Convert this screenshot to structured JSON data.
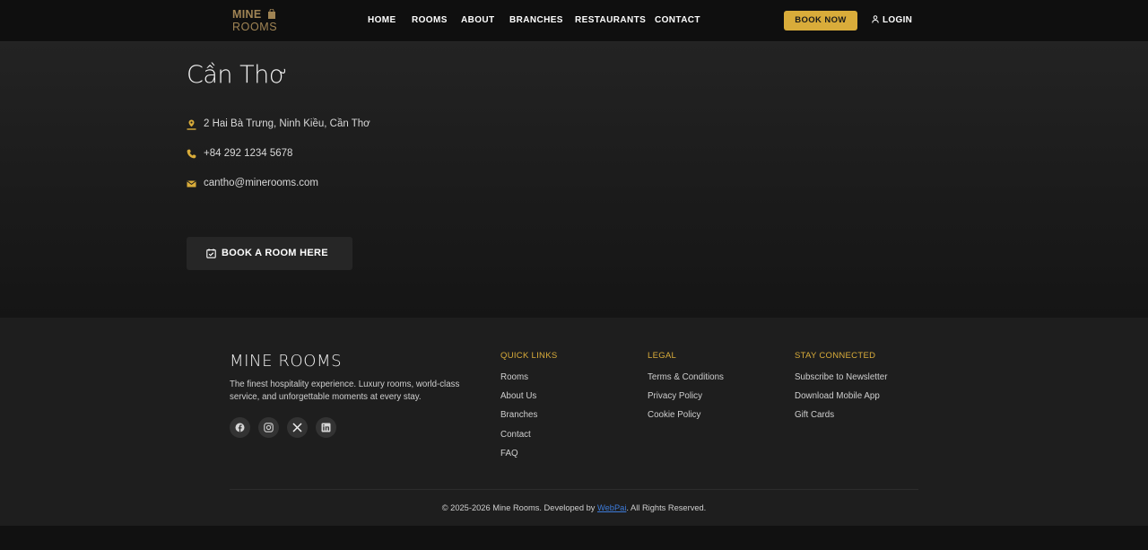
{
  "nav": {
    "logo_line1": "MINE",
    "logo_line2": "ROOMS",
    "items": [
      "HOME",
      "ROOMS",
      "ABOUT",
      "BRANCHES",
      "RESTAURANTS",
      "CONTACT"
    ],
    "book_now": "BOOK NOW",
    "login": "LOGIN",
    "icons": {
      "login": "user-icon",
      "logo": "shopping-bag-icon"
    }
  },
  "branch": {
    "city": "Cần Thơ",
    "address": "2 Hai Bà Trưng, Ninh Kiều, Cần Thơ",
    "phone": "+84 292 1234 5678",
    "email": "cantho@minerooms.com",
    "book_button": "BOOK A ROOM HERE",
    "icons": {
      "address": "location-pin-icon",
      "phone": "phone-icon",
      "email": "mail-icon",
      "book": "calendar-check-icon"
    }
  },
  "footer": {
    "brand": "MINE ROOMS",
    "tagline": "The finest hospitality experience. Luxury rooms, world-class service, and unforgettable moments at every stay.",
    "socials": [
      "facebook-icon",
      "instagram-icon",
      "x-icon",
      "linkedin-icon"
    ],
    "quick_links": {
      "title": "QUICK LINKS",
      "links": [
        "Rooms",
        "About Us",
        "Branches",
        "Contact",
        "FAQ"
      ]
    },
    "legal": {
      "title": "LEGAL",
      "links": [
        "Terms & Conditions",
        "Privacy Policy",
        "Cookie Policy"
      ]
    },
    "stay_connected": {
      "title": "STAY CONNECTED",
      "links": [
        "Subscribe to Newsletter",
        "Download Mobile App",
        "Gift Cards"
      ]
    },
    "copyright_prefix": "© 2025-2026 Mine Rooms. Developed by ",
    "developer": "WebPai",
    "copyright_suffix": ". All Rights Reserved."
  },
  "colors": {
    "accent": "#d9ac3a",
    "logo": "#a08454",
    "link": "#3d7bd9"
  }
}
